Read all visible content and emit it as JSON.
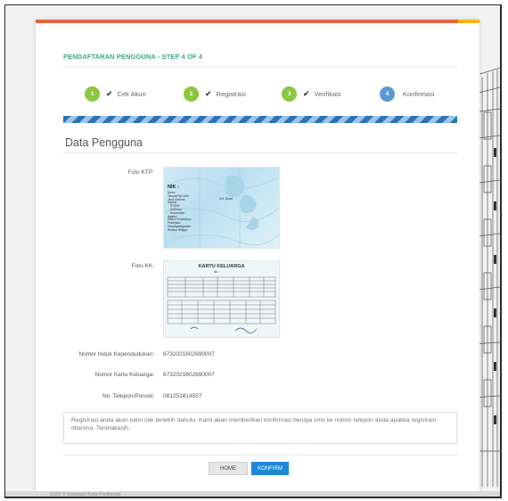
{
  "wizard": {
    "title": "PENDAFTARAN PENGGUNA - STEP 4 OF 4",
    "steps": [
      {
        "number": "1",
        "label": "Cek Akun",
        "done": true
      },
      {
        "number": "2",
        "label": "Registrasi",
        "done": true
      },
      {
        "number": "3",
        "label": "Verifikasi",
        "done": true
      },
      {
        "number": "4",
        "label": "Konfirmasi",
        "done": false
      }
    ],
    "check_glyph": "✔",
    "progress": 1.0
  },
  "section": {
    "title": "Data Pengguna"
  },
  "fields": {
    "ktp_label": "Foto KTP:",
    "kk_label": "Foto KK:",
    "nik_label": "Nomor Induk Kependudukan:",
    "nik_value": "6732021602690007",
    "kk_number_label": "Nomor Kartu Keluarga:",
    "kk_number_value": "6732021602690007",
    "phone_label": "No. Telepon/Ponsel:",
    "phone_value": "081251814557"
  },
  "images": {
    "ktp": {
      "nik": "NIK :",
      "rows": [
        "Nama",
        "Tempat/Tgl Lahir",
        "Jenis Kelamin",
        "Alamat",
        "RT/RW",
        "Kel/Desa",
        "Kecamatan",
        "Agama",
        "Status Perkawinan",
        "Pekerjaan",
        "Kewarganegaraan",
        "Berlaku Hingga"
      ],
      "gol_darah": "Gol. Darah"
    },
    "kk": {
      "heading": "KARTU KELUARGA",
      "no": "No."
    }
  },
  "notice": {
    "text": "Registrasi anda akan kami cek terlebih dahulu. Kami akan memberikan konfirmasi berupa sms ke nomor telepon anda apabila registrasi diterima. Terimakasih."
  },
  "buttons": {
    "home": "HOME",
    "confirm": "KONFIRM"
  },
  "footer": {
    "text": "2020 © Dukdapil Kota Pontianak"
  },
  "colors": {
    "accent_green": "#39a88b",
    "step_done": "#8cc63f",
    "step_active": "#5b9bd5",
    "primary_button": "#1e88d6",
    "top_bar": "#e5633e"
  }
}
